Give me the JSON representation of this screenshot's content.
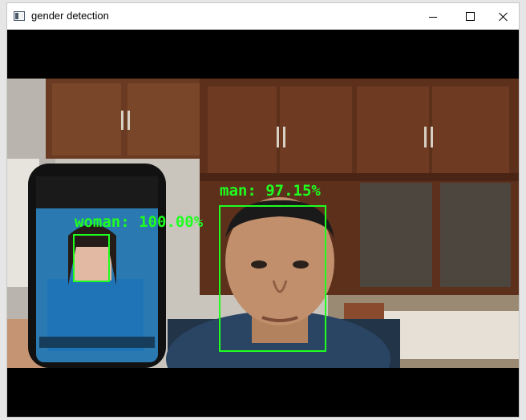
{
  "window": {
    "title": "gender detection",
    "icon": "app-window-icon",
    "controls": [
      "minimize-icon",
      "maximize-icon",
      "close-icon"
    ]
  },
  "detections": [
    {
      "label": "woman: 100.00%",
      "gender": "woman",
      "confidence": 100.0
    },
    {
      "label": "man: 97.15%",
      "gender": "man",
      "confidence": 97.15
    }
  ],
  "colors": {
    "detection": "#1fff1f",
    "letterbox": "#000000",
    "titlebar": "#ffffff"
  }
}
